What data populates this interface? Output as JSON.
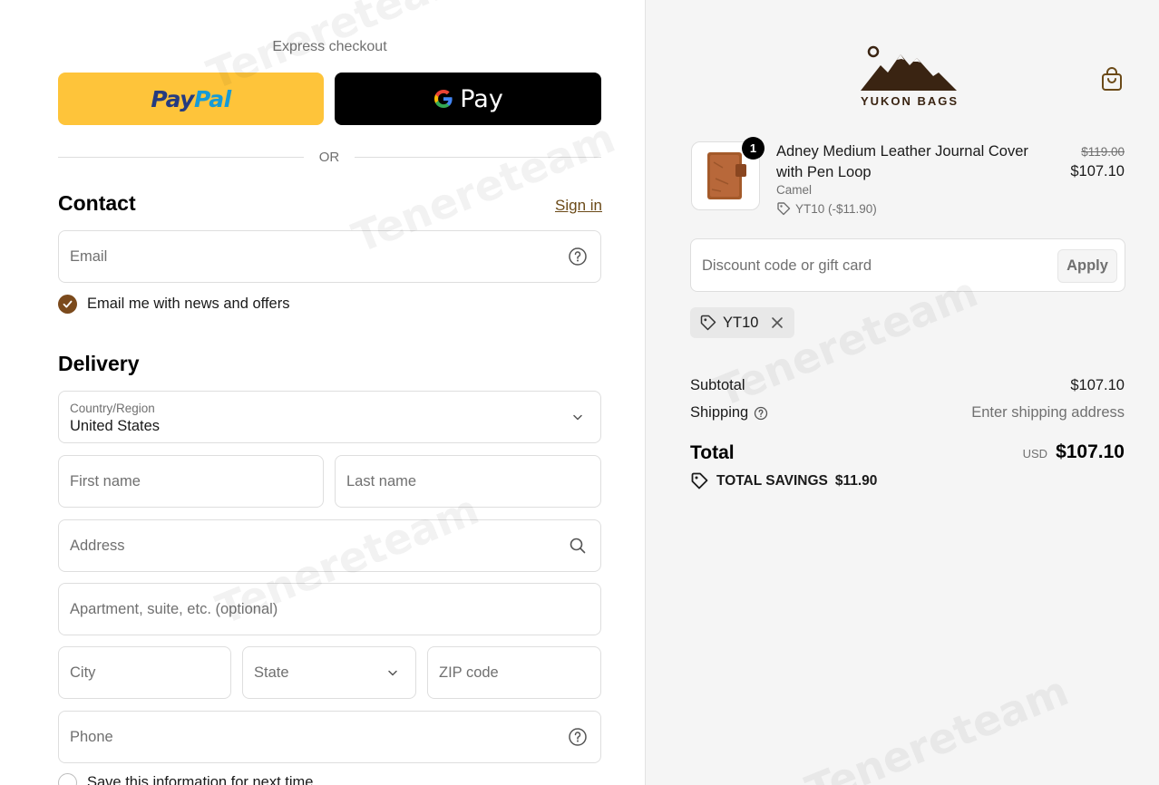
{
  "express": {
    "title": "Express checkout",
    "paypal_label": "PayPal",
    "paypal_pay": "Pay",
    "paypal_pal": "Pal",
    "gpay_label": "Pay",
    "or_label": "OR"
  },
  "contact": {
    "title": "Contact",
    "signin_label": "Sign in",
    "email_placeholder": "Email",
    "newsletter_label": "Email me with news and offers",
    "newsletter_checked": true
  },
  "delivery": {
    "title": "Delivery",
    "country_label": "Country/Region",
    "country_value": "United States",
    "first_name_placeholder": "First name",
    "last_name_placeholder": "Last name",
    "address_placeholder": "Address",
    "apartment_placeholder": "Apartment, suite, etc. (optional)",
    "city_placeholder": "City",
    "state_placeholder": "State",
    "zip_placeholder": "ZIP code",
    "phone_placeholder": "Phone",
    "save_info_label": "Save this information for next time"
  },
  "brand": {
    "name": "YUKON BAGS",
    "color": "#3a2412"
  },
  "order": {
    "item": {
      "name": "Adney Medium Leather Journal Cover with Pen Loop",
      "variant": "Camel",
      "discount": "YT10 (-$11.90)",
      "quantity": "1",
      "price_original": "$119.00",
      "price_final": "$107.10"
    },
    "discount_placeholder": "Discount code or gift card",
    "apply_label": "Apply",
    "applied_code": "YT10",
    "subtotal_label": "Subtotal",
    "subtotal_value": "$107.10",
    "shipping_label": "Shipping",
    "shipping_value": "Enter shipping address",
    "total_label": "Total",
    "total_currency": "USD",
    "total_value": "$107.10",
    "savings_label": "TOTAL SAVINGS",
    "savings_value": "$11.90"
  },
  "watermark_text": "Tenereteam",
  "colors": {
    "accent_brown": "#7b4a1c",
    "paypal_yellow": "#fec43a",
    "link_brown": "#6b4a18"
  }
}
